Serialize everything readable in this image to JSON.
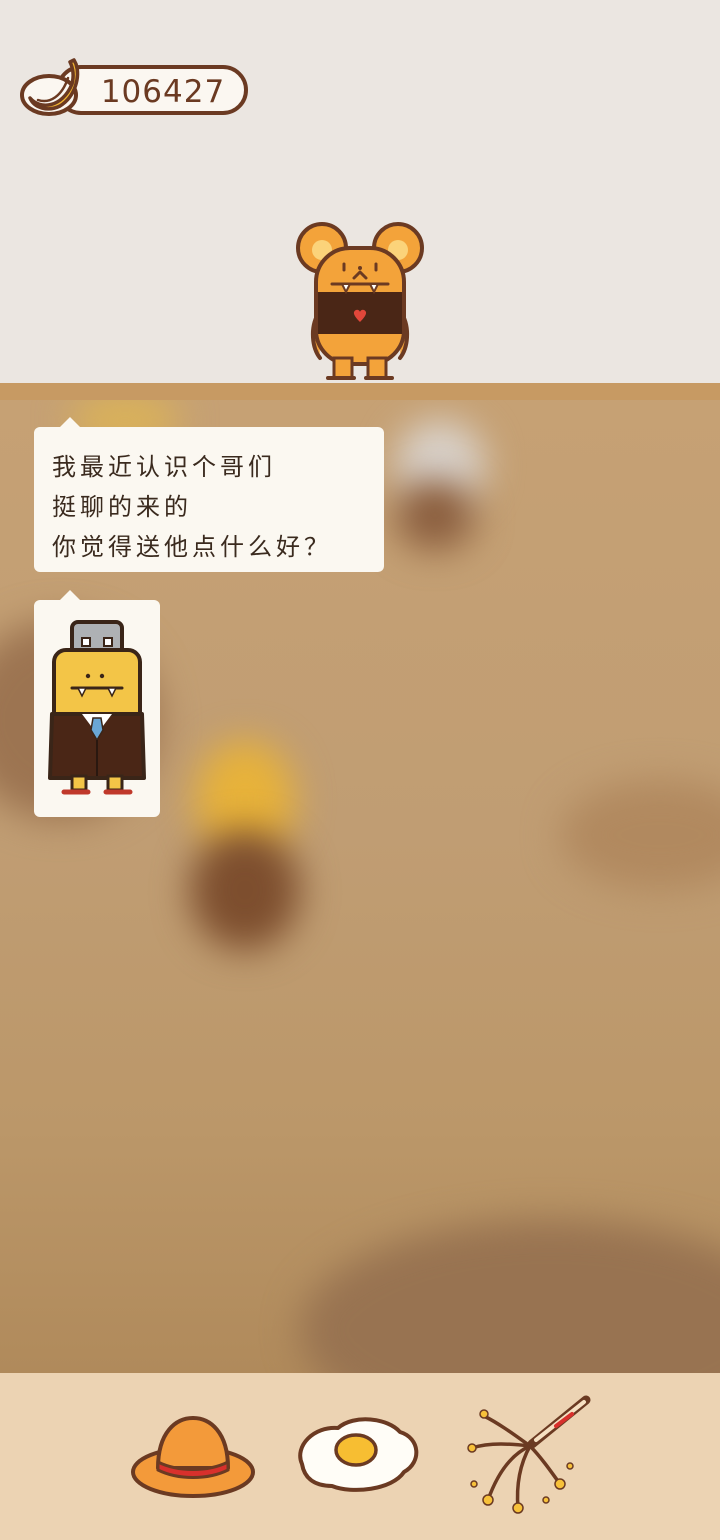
{
  "hud": {
    "coin_icon": "banana-icon",
    "coin_count": "106427"
  },
  "character": {
    "name_icon": "mouse-character"
  },
  "dialog": {
    "lines": [
      "我最近认识个哥们",
      "挺聊的来的",
      "你觉得送他点什么好？"
    ],
    "attachment_icon": "robot-suit-character-icon"
  },
  "toolbar": {
    "items": [
      {
        "icon": "straw-hat-icon"
      },
      {
        "icon": "fried-egg-icon"
      },
      {
        "icon": "sparkler-icon"
      }
    ]
  },
  "colors": {
    "accent_brown": "#6b3a22",
    "shelf": "#c79a63",
    "bottom_bar": "#ecd3b3"
  }
}
